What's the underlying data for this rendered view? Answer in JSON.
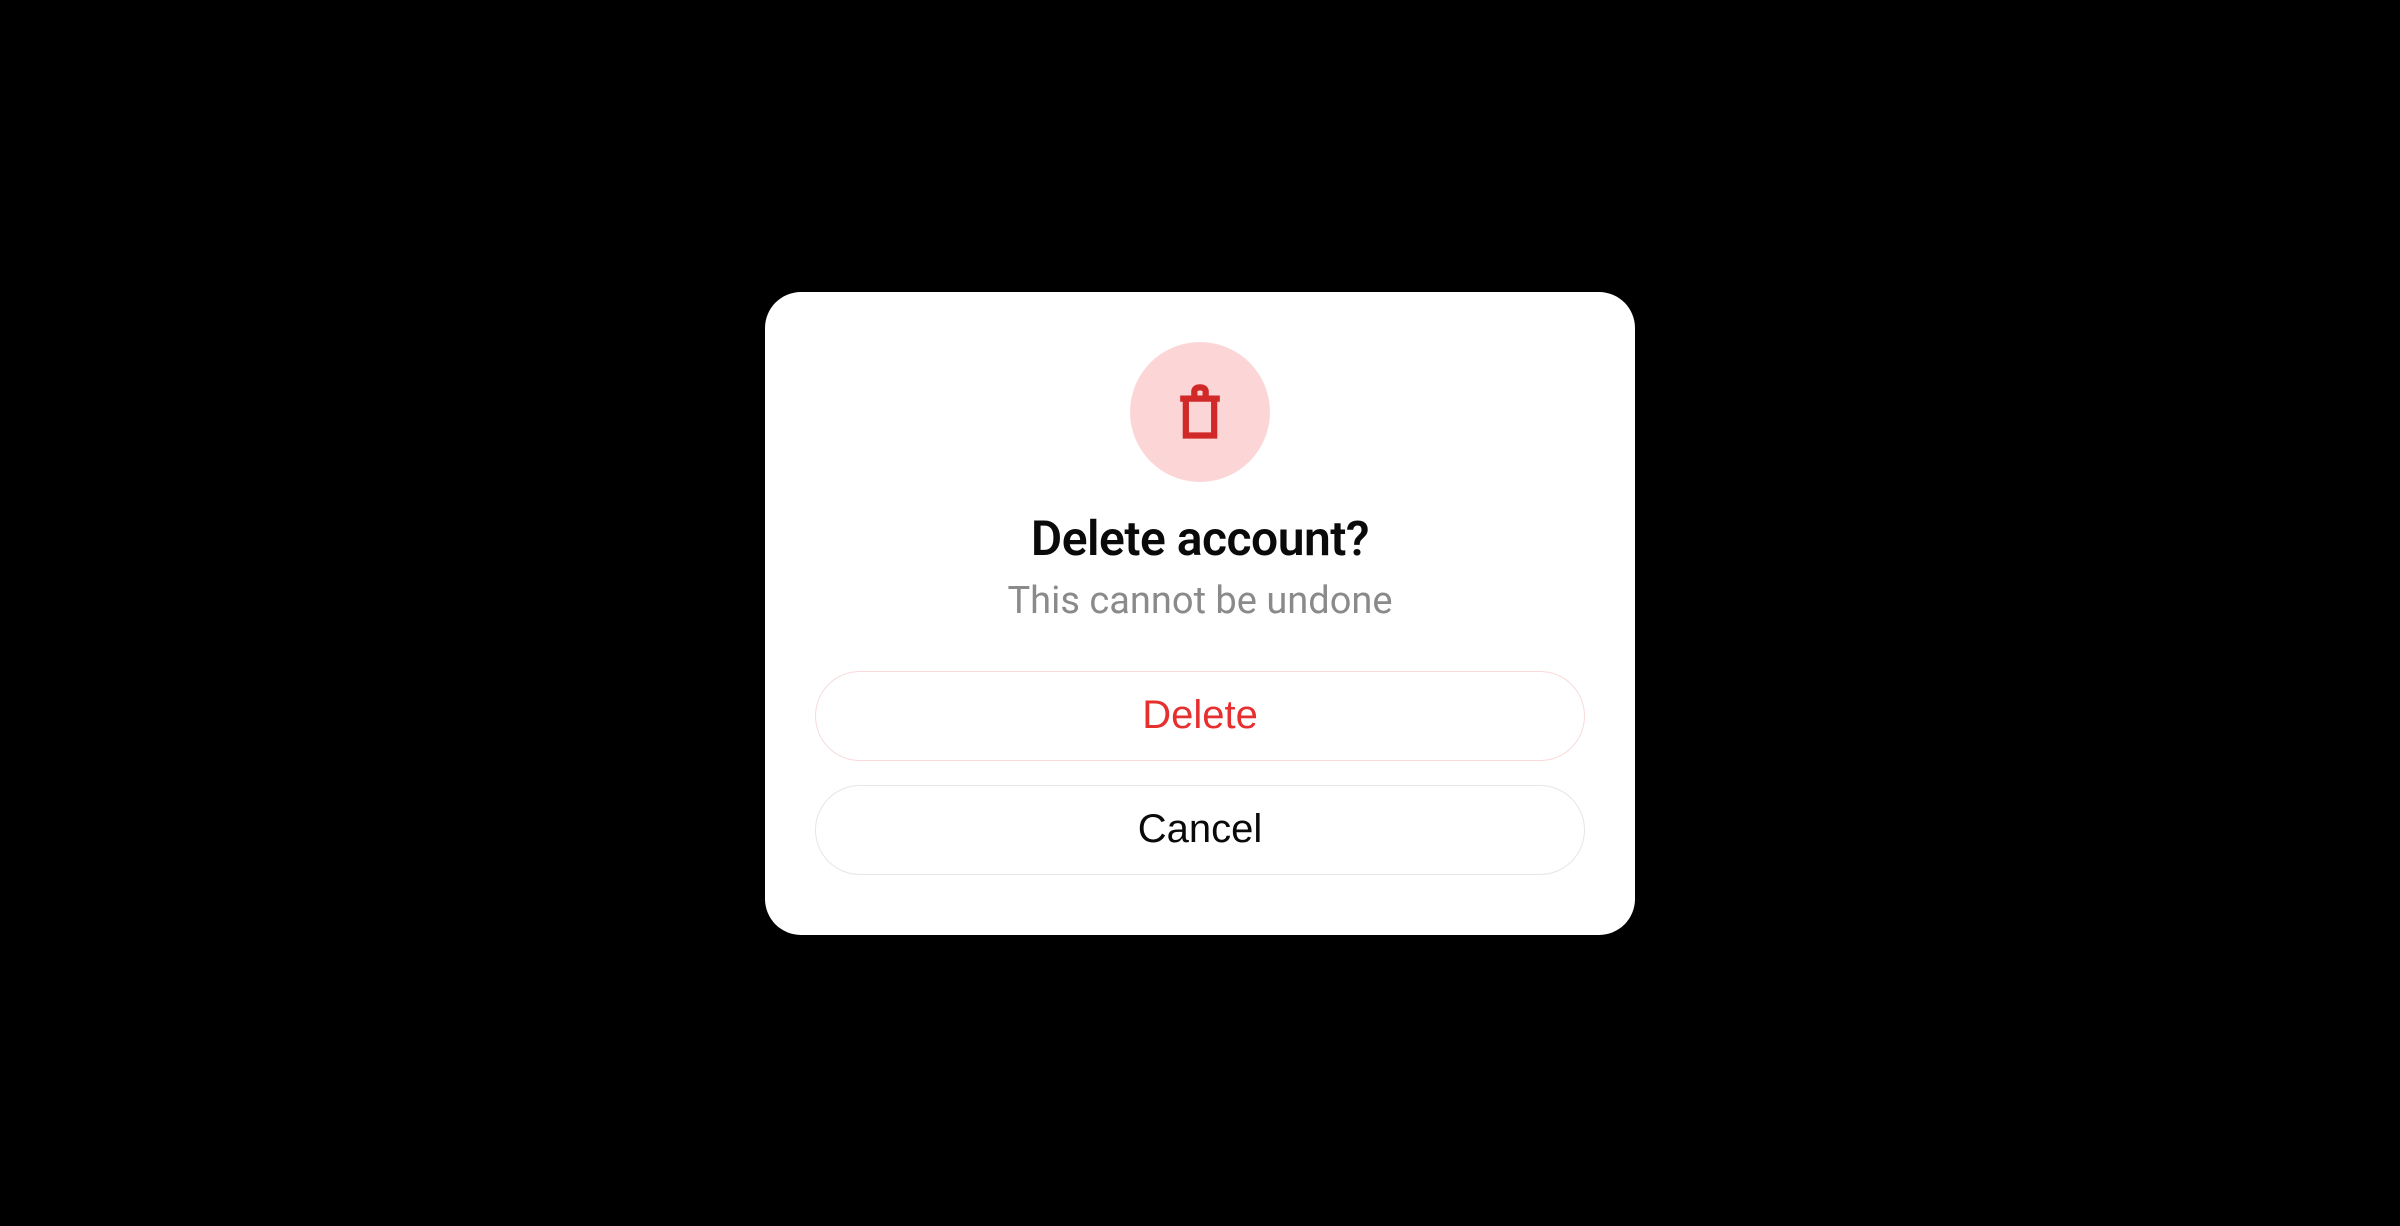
{
  "dialog": {
    "icon": "trash-icon",
    "title": "Delete account?",
    "subtitle": "This cannot be undone",
    "buttons": {
      "delete": "Delete",
      "cancel": "Cancel"
    },
    "colors": {
      "danger": "#e63030",
      "iconBg": "#fcd6d6",
      "subtitle": "#8a8a8a"
    }
  }
}
